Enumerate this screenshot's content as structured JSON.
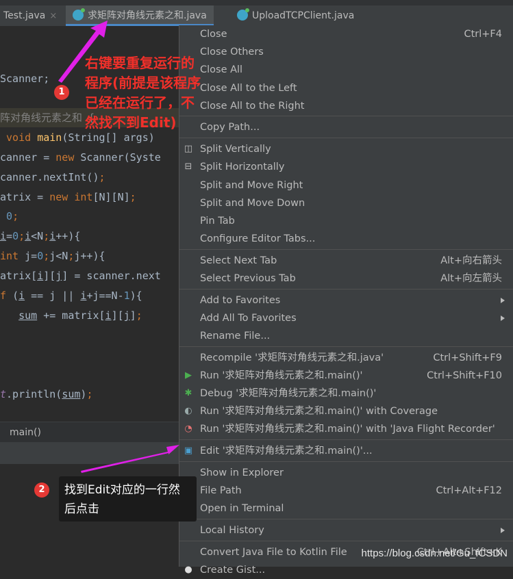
{
  "tabs": [
    {
      "label": "Test.java"
    },
    {
      "label": "求矩阵对角线元素之和.java",
      "active": true
    },
    {
      "label": "UploadTCPClient.java"
    }
  ],
  "close_glyph": "×",
  "code": [
    {
      "t": 101,
      "s": [
        [
          "Scanner;",
          ""
        ]
      ]
    },
    {
      "t": 158,
      "h": true,
      "s": [
        [
          "阵对角线元素之和 {",
          "cm"
        ]
      ]
    },
    {
      "t": 187,
      "s": [
        [
          " void ",
          "kw"
        ],
        [
          "main",
          "fn"
        ],
        [
          "(String[] args)",
          ""
        ]
      ]
    },
    {
      "t": 216,
      "s": [
        [
          "canner = ",
          ""
        ],
        [
          "new ",
          "kw"
        ],
        [
          "Scanner(Syste",
          ""
        ]
      ]
    },
    {
      "t": 245,
      "s": [
        [
          "canner.nextInt()",
          ""
        ],
        [
          ";",
          "kw"
        ]
      ]
    },
    {
      "t": 274,
      "s": [
        [
          "atrix = ",
          ""
        ],
        [
          "new int",
          "kw"
        ],
        [
          "[N][N]",
          ""
        ],
        [
          ";",
          "kw"
        ]
      ]
    },
    {
      "t": 302,
      "s": [
        [
          " ",
          ""
        ],
        [
          "0",
          "num"
        ],
        [
          ";",
          "kw"
        ]
      ]
    },
    {
      "t": 331,
      "s": [
        [
          "i",
          "u"
        ],
        [
          "=",
          ""
        ],
        [
          "0",
          "num"
        ],
        [
          ";",
          "kw"
        ],
        [
          "i",
          "u"
        ],
        [
          "<N",
          ""
        ],
        [
          ";",
          "kw"
        ],
        [
          "i",
          "u"
        ],
        [
          "++){",
          ""
        ]
      ]
    },
    {
      "t": 360,
      "s": [
        [
          "int ",
          "kw"
        ],
        [
          "j=",
          ""
        ],
        [
          "0",
          "num"
        ],
        [
          ";",
          "kw"
        ],
        [
          "j<N",
          ""
        ],
        [
          ";",
          "kw"
        ],
        [
          "j++){",
          ""
        ]
      ]
    },
    {
      "t": 389,
      "s": [
        [
          "atrix[",
          ""
        ],
        [
          "i",
          "u"
        ],
        [
          "][",
          ""
        ],
        [
          "j",
          "u"
        ],
        [
          "] = scanner.next",
          ""
        ]
      ]
    },
    {
      "t": 418,
      "s": [
        [
          "f ",
          "kw"
        ],
        [
          "(",
          ""
        ],
        [
          "i",
          "u"
        ],
        [
          " == j || ",
          ""
        ],
        [
          "i",
          "u"
        ],
        [
          "+j==N-",
          ""
        ],
        [
          "1",
          "num"
        ],
        [
          "){",
          ""
        ]
      ]
    },
    {
      "t": 447,
      "s": [
        [
          "   ",
          ""
        ],
        [
          "sum",
          "u"
        ],
        [
          " += matrix[",
          ""
        ],
        [
          "i",
          "u"
        ],
        [
          "][",
          ""
        ],
        [
          "j",
          "u"
        ],
        [
          "]",
          ""
        ],
        [
          ";",
          "kw"
        ]
      ]
    },
    {
      "t": 562,
      "s": [
        [
          "t",
          "it"
        ],
        [
          ".println(",
          ""
        ],
        [
          "sum",
          "u"
        ],
        [
          ")",
          ""
        ],
        [
          ";",
          "kw"
        ]
      ]
    }
  ],
  "breadcrumb": "main()",
  "menu": [
    [
      {
        "label": "Close",
        "sc": "Ctrl+F4"
      },
      {
        "label": "Close Others"
      },
      {
        "label": "Close All"
      },
      {
        "label": "Close All to the Left"
      },
      {
        "label": "Close All to the Right"
      }
    ],
    [
      {
        "label": "Copy Path..."
      }
    ],
    [
      {
        "label": "Split Vertically",
        "icon": "split-vertical-icon",
        "glyph": "◫"
      },
      {
        "label": "Split Horizontally",
        "icon": "split-horizontal-icon",
        "glyph": "⊟"
      },
      {
        "label": "Split and Move Right"
      },
      {
        "label": "Split and Move Down"
      },
      {
        "label": "Pin Tab"
      },
      {
        "label": "Configure Editor Tabs..."
      }
    ],
    [
      {
        "label": "Select Next Tab",
        "sc": "Alt+向右箭头"
      },
      {
        "label": "Select Previous Tab",
        "sc": "Alt+向左箭头"
      }
    ],
    [
      {
        "label": "Add to Favorites",
        "sub": true
      },
      {
        "label": "Add All To Favorites",
        "sub": true
      },
      {
        "label": "Rename File..."
      }
    ],
    [
      {
        "label": "Recompile '求矩阵对角线元素之和.java'",
        "sc": "Ctrl+Shift+F9"
      },
      {
        "label": "Run '求矩阵对角线元素之和.main()'",
        "sc": "Ctrl+Shift+F10",
        "icon": "run-icon",
        "glyph": "▶",
        "color": "#4caf50"
      },
      {
        "label": "Debug '求矩阵对角线元素之和.main()'",
        "icon": "debug-icon",
        "glyph": "✱",
        "color": "#4caf50"
      },
      {
        "label": "Run '求矩阵对角线元素之和.main()' with Coverage",
        "icon": "coverage-icon",
        "glyph": "◐",
        "color": "#9aa"
      },
      {
        "label": "Run '求矩阵对角线元素之和.main()' with 'Java Flight Recorder'",
        "icon": "profiler-icon",
        "glyph": "◔",
        "color": "#e57373"
      }
    ],
    [
      {
        "label": "Edit '求矩阵对角线元素之和.main()'...",
        "icon": "edit-configuration-icon",
        "glyph": "▣",
        "color": "#4a9fd0"
      }
    ],
    [
      {
        "label": "Show in Explorer"
      },
      {
        "label": "File Path",
        "sc": "Ctrl+Alt+F12"
      },
      {
        "label": "Open in Terminal",
        "icon": "terminal-icon",
        "glyph": "▭",
        "color": "#888"
      }
    ],
    [
      {
        "label": "Local History",
        "sub": true
      }
    ],
    [
      {
        "label": "Convert Java File to Kotlin File",
        "sc": "Ctrl+Alt+Shift+K"
      },
      {
        "label": "Create Gist...",
        "icon": "github-icon",
        "glyph": "●",
        "color": "#ddd"
      }
    ]
  ],
  "annotation1": "右键要重复运行的程序(前提是该程序已经在运行了，不然找不到Edit)",
  "badge1": "1",
  "badge2": "2",
  "annotation2": "找到Edit对应的一行然后点击",
  "watermark": "https://blog.csdn.net/Gu_fCSDN",
  "colors": {
    "arrow": "#e020e8",
    "accent": "#4a88c7"
  }
}
